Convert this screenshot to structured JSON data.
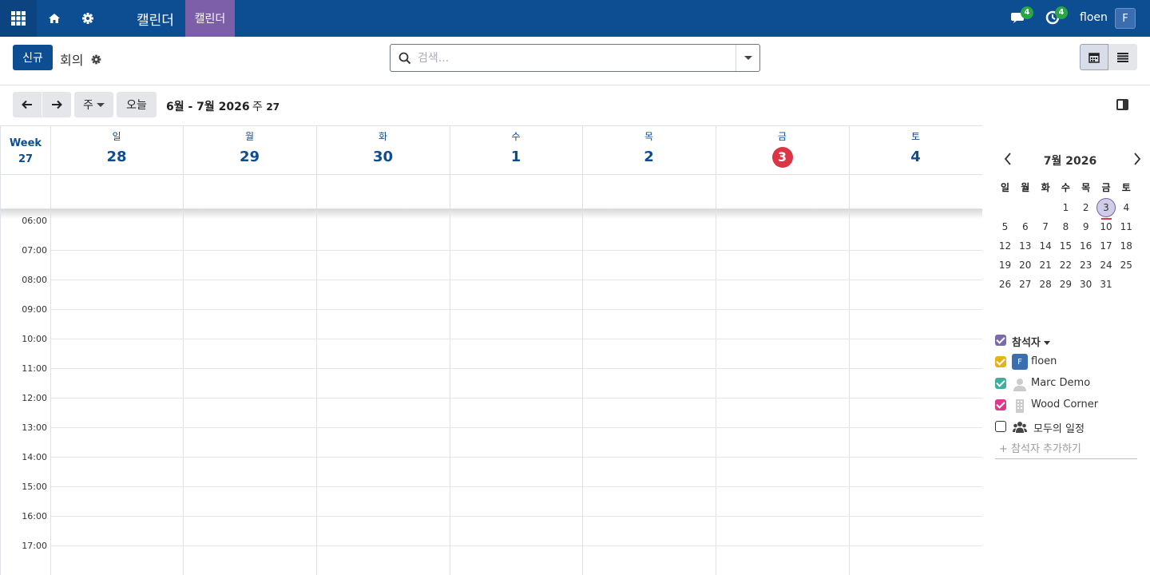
{
  "navbar": {
    "brand": "캘린더",
    "menu_item": "캘린더",
    "chat_count": "4",
    "activity_count": "4",
    "user_name": "floen",
    "user_initial": "F",
    "color": "#0d4d91"
  },
  "control": {
    "new_label": "신규",
    "breadcrumb": "회의",
    "search_placeholder": "검색..."
  },
  "toolbar": {
    "scale_label": "주",
    "today_label": "오늘",
    "range_title": "6월 - 7월 2026",
    "week_prefix": "주",
    "week_number": "27"
  },
  "grid": {
    "week_label": "Week",
    "week_number": "27",
    "days": [
      {
        "name": "일",
        "num": "28"
      },
      {
        "name": "월",
        "num": "29"
      },
      {
        "name": "화",
        "num": "30"
      },
      {
        "name": "수",
        "num": "1"
      },
      {
        "name": "목",
        "num": "2"
      },
      {
        "name": "금",
        "num": "3",
        "today": true
      },
      {
        "name": "토",
        "num": "4"
      }
    ],
    "hours": [
      "06:00",
      "07:00",
      "08:00",
      "09:00",
      "10:00",
      "11:00",
      "12:00",
      "13:00",
      "14:00",
      "15:00",
      "16:00",
      "17:00"
    ]
  },
  "mini_calendar": {
    "title": "7월 2026",
    "dow": [
      "일",
      "월",
      "화",
      "수",
      "목",
      "금",
      "토"
    ],
    "weeks": [
      [
        "",
        "",
        "",
        "1",
        "2",
        "3",
        "4"
      ],
      [
        "5",
        "6",
        "7",
        "8",
        "9",
        "10",
        "11"
      ],
      [
        "12",
        "13",
        "14",
        "15",
        "16",
        "17",
        "18"
      ],
      [
        "19",
        "20",
        "21",
        "22",
        "23",
        "24",
        "25"
      ],
      [
        "26",
        "27",
        "28",
        "29",
        "30",
        "31",
        ""
      ]
    ],
    "today": "3"
  },
  "filters": {
    "group_label": "참석자",
    "items": [
      {
        "label": "floen",
        "initial": "F",
        "color": "#e6b412",
        "checked": true
      },
      {
        "label": "Marc Demo",
        "color": "#3fae9e",
        "checked": true
      },
      {
        "label": "Wood Corner",
        "color": "#e0388b",
        "checked": true
      },
      {
        "label": "모두의 일정",
        "checked": false
      }
    ],
    "group_color": "#7c6bab",
    "add_label": "+ 참석자 추가하기"
  }
}
